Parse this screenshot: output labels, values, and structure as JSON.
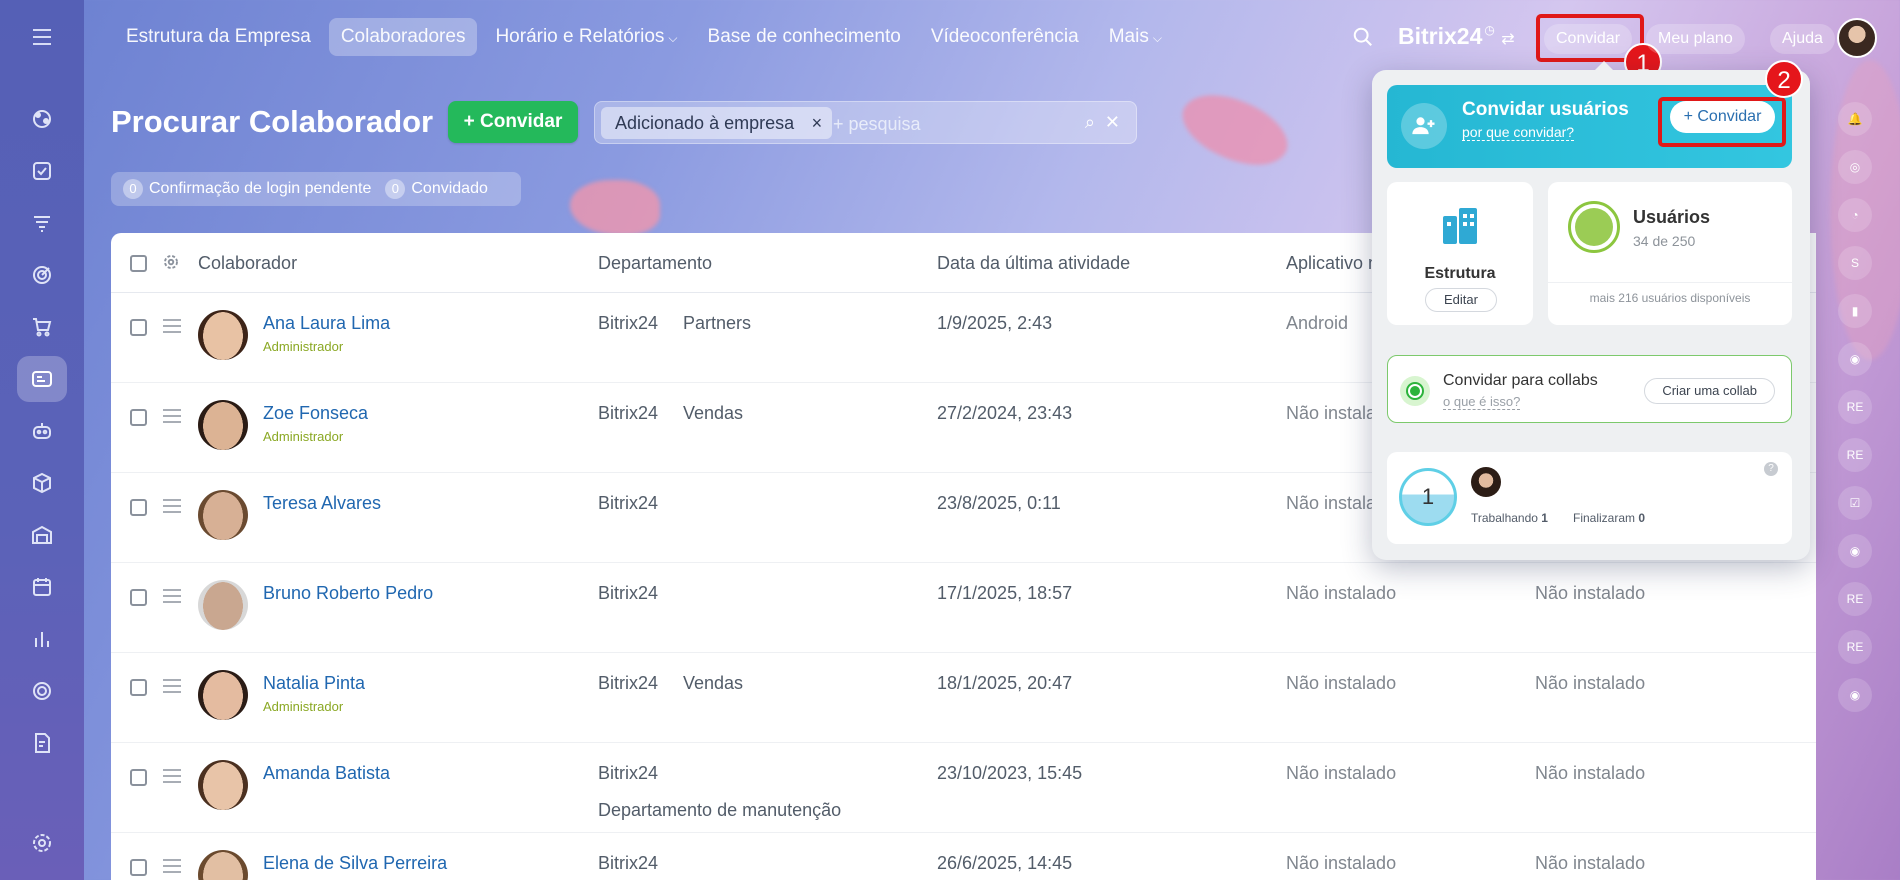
{
  "topbar": {
    "nav": [
      {
        "label": "Estrutura da Empresa",
        "active": false,
        "dropdown": false
      },
      {
        "label": "Colaboradores",
        "active": true,
        "dropdown": false
      },
      {
        "label": "Horário e Relatórios",
        "active": false,
        "dropdown": true
      },
      {
        "label": "Base de conhecimento",
        "active": false,
        "dropdown": false
      },
      {
        "label": "Vídeoconferência",
        "active": false,
        "dropdown": false
      },
      {
        "label": "Mais",
        "active": false,
        "dropdown": true
      }
    ],
    "logo": "Bitrix",
    "logo_number": "24",
    "invite_label": "Convidar",
    "plan_label": "Meu plano",
    "help_label": "Ajuda",
    "annotation_1": "1",
    "annotation_2": "2"
  },
  "page": {
    "title": "Procurar Colaborador",
    "invite_button": "+ Convidar",
    "filter_chip": "Adicionado à empresa",
    "filter_placeholder": "+ pesquisa",
    "counters": [
      {
        "count": "0",
        "label": "Confirmação de login pendente"
      },
      {
        "count": "0",
        "label": "Convidado"
      }
    ]
  },
  "table": {
    "headers": [
      "Colaborador",
      "Departamento",
      "Data da última atividade",
      "Aplicativo m"
    ],
    "rows": [
      {
        "name": "Ana Laura Lima",
        "role": "Administrador",
        "company": "Bitrix24",
        "dept": "Partners",
        "dept2": "",
        "date": "1/9/2025, 2:43",
        "app": "Android",
        "app2": "",
        "skin": "#e8c2a4",
        "hair": "#3d2418"
      },
      {
        "name": "Zoe Fonseca",
        "role": "Administrador",
        "company": "Bitrix24",
        "dept": "Vendas",
        "dept2": "",
        "date": "27/2/2024, 23:43",
        "app": "Não instala",
        "app2": "",
        "skin": "#dcb394",
        "hair": "#2a1b14"
      },
      {
        "name": "Teresa Alvares",
        "role": "",
        "company": "Bitrix24",
        "dept": "",
        "dept2": "",
        "date": "23/8/2025, 0:11",
        "app": "Não instala",
        "app2": "",
        "skin": "#d7b095",
        "hair": "#6a4a30"
      },
      {
        "name": "Bruno Roberto Pedro",
        "role": "",
        "company": "Bitrix24",
        "dept": "",
        "dept2": "",
        "date": "17/1/2025, 18:57",
        "app": "Não instalado",
        "app2": "Não instalado",
        "skin": "#c9a790",
        "hair": "#d8d8d8"
      },
      {
        "name": "Natalia Pinta",
        "role": "Administrador",
        "company": "Bitrix24",
        "dept": "Vendas",
        "dept2": "",
        "date": "18/1/2025, 20:47",
        "app": "Não instalado",
        "app2": "Não instalado",
        "skin": "#e4bba0",
        "hair": "#2b1c16"
      },
      {
        "name": "Amanda Batista",
        "role": "",
        "company": "Bitrix24",
        "dept": "",
        "dept2": "Departamento de manutenção",
        "date": "23/10/2023, 15:45",
        "app": "Não instalado",
        "app2": "Não instalado",
        "skin": "#e8c4a8",
        "hair": "#4b3020"
      },
      {
        "name": "Elena de Silva Perreira",
        "role": "",
        "company": "Bitrix24",
        "dept": "",
        "dept2": "",
        "date": "26/6/2025, 14:45",
        "app": "Não instalado",
        "app2": "Não instalado",
        "skin": "#e2bfa3",
        "hair": "#6b4a2e"
      }
    ]
  },
  "popup": {
    "title": "Convidar usuários",
    "link": "por que convidar?",
    "invite_button": "+ Convidar",
    "structure_title": "Estrutura",
    "edit_button": "Editar",
    "users_title": "Usuários",
    "users_count": "34 de 250",
    "users_available": "mais 216 usuários disponíveis",
    "collab_title": "Convidar para collabs",
    "collab_link": "o que é isso?",
    "collab_button": "Criar uma collab",
    "stat_circle": "1",
    "working_label": "Trabalhando",
    "working_count": "1",
    "finished_label": "Finalizaram",
    "finished_count": "0",
    "help": "?"
  },
  "right_bar": [
    "bell-icon",
    "radar-icon",
    "chat-icon",
    "S",
    "bookmark-icon",
    "avatar",
    "RE",
    "RE",
    "checklist-icon",
    "avatar",
    "RE",
    "RE",
    "avatar"
  ],
  "colors": {
    "accent_green": "#24b95b",
    "popup_cyan": "#25b7d3",
    "highlight_red": "#e01818",
    "link_blue": "#2067b0",
    "admin_green": "#8aa823"
  }
}
